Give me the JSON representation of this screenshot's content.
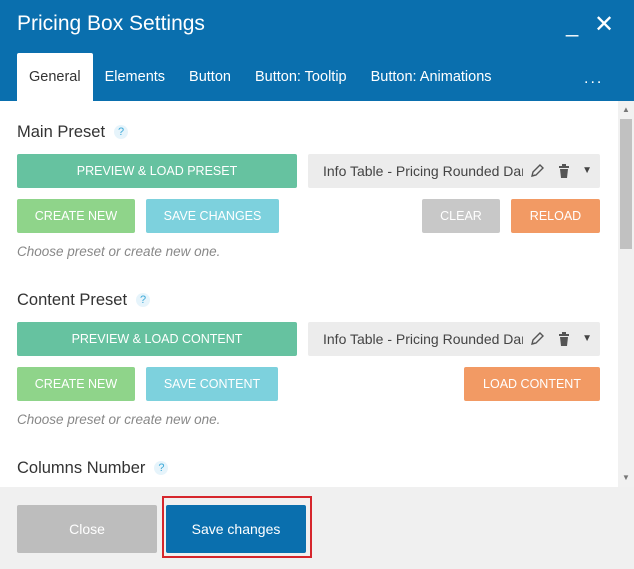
{
  "window": {
    "title": "Pricing Box Settings",
    "minimize_glyph": "_",
    "close_glyph": "✕"
  },
  "tabs": [
    {
      "label": "General",
      "active": true
    },
    {
      "label": "Elements",
      "active": false
    },
    {
      "label": "Button",
      "active": false
    },
    {
      "label": "Button: Tooltip",
      "active": false
    },
    {
      "label": "Button: Animations",
      "active": false
    }
  ],
  "tabs_more_glyph": "...",
  "main_preset": {
    "title": "Main Preset",
    "help": "?",
    "preview_load": "PREVIEW & LOAD PRESET",
    "select_value": "Info Table - Pricing Rounded Dark",
    "create_new": "CREATE NEW",
    "save_changes": "SAVE CHANGES",
    "clear": "CLEAR",
    "reload": "RELOAD",
    "hint": "Choose preset or create new one."
  },
  "content_preset": {
    "title": "Content Preset",
    "help": "?",
    "preview_load": "PREVIEW & LOAD CONTENT",
    "select_value": "Info Table - Pricing Rounded Dark",
    "create_new": "CREATE NEW",
    "save_content": "SAVE CONTENT",
    "load_content": "LOAD CONTENT",
    "hint": "Choose preset or create new one."
  },
  "columns_number": {
    "title": "Columns Number",
    "help": "?"
  },
  "footer": {
    "close": "Close",
    "save": "Save changes"
  },
  "colors": {
    "header": "#0a6fae",
    "accent_highlight": "#d6262c"
  }
}
